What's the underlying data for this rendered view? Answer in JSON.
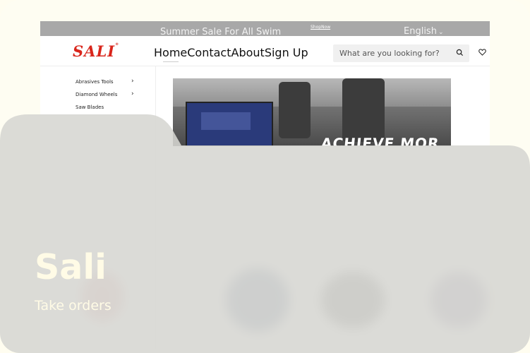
{
  "promo": {
    "message": "Summer Sale For All Swim",
    "shop_link": "ShopNow",
    "language": "English"
  },
  "header": {
    "logo": "SALI",
    "nav": [
      "Home",
      "Contact",
      "About",
      "Sign Up"
    ],
    "search_placeholder": "What are you looking for?"
  },
  "sidebar": {
    "items": [
      {
        "label": "Abrasives Tools"
      },
      {
        "label": "Diamond Wheels"
      },
      {
        "label": "Saw Blades"
      }
    ]
  },
  "banner": {
    "headline": "ACHIEVE MOR"
  },
  "overlay": {
    "title": "Sali",
    "subtitle": "Take orders"
  },
  "colors": {
    "brand": "#d9261c",
    "promo_bg": "#a8a8a8",
    "overlay_text": "#fffbe6"
  }
}
